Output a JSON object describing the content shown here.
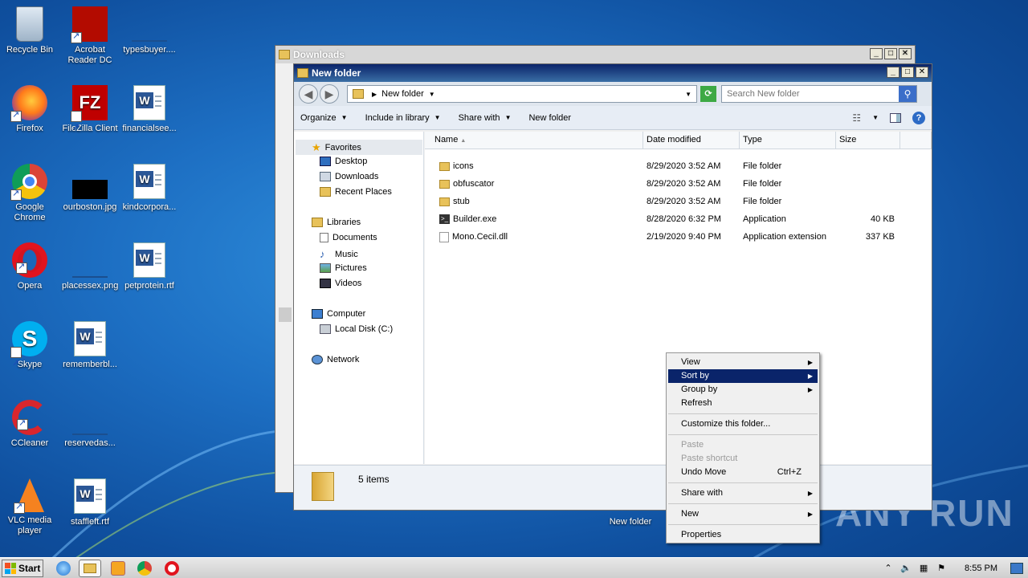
{
  "desktop": {
    "icons": [
      {
        "label": "Recycle Bin"
      },
      {
        "label": "Acrobat Reader DC"
      },
      {
        "label": "typesbuyer...."
      },
      {
        "label": "Firefox"
      },
      {
        "label": "FileZilla Client"
      },
      {
        "label": "financialsee..."
      },
      {
        "label": "Google Chrome"
      },
      {
        "label": "ourboston.jpg"
      },
      {
        "label": "kindcorpora..."
      },
      {
        "label": "Opera"
      },
      {
        "label": "placessex.png"
      },
      {
        "label": "petprotein.rtf"
      },
      {
        "label": "Skype"
      },
      {
        "label": "rememberbl..."
      },
      {
        "label": "CCleaner"
      },
      {
        "label": "reservedas..."
      },
      {
        "label": "VLC media player"
      },
      {
        "label": "staffleft.rtf"
      },
      {
        "label": "New folder"
      }
    ],
    "watermark": "ANY RUN"
  },
  "back_window": {
    "title": "Downloads"
  },
  "explorer": {
    "title": "New folder",
    "address": "New folder",
    "search_placeholder": "Search New folder",
    "commands": [
      "Organize",
      "Include in library",
      "Share with",
      "New folder"
    ],
    "nav": {
      "favorites": "Favorites",
      "fav_items": [
        "Desktop",
        "Downloads",
        "Recent Places"
      ],
      "libraries": "Libraries",
      "lib_items": [
        "Documents",
        "Music",
        "Pictures",
        "Videos"
      ],
      "computer": "Computer",
      "comp_items": [
        "Local Disk (C:)"
      ],
      "network": "Network"
    },
    "columns": [
      "Name",
      "Date modified",
      "Type",
      "Size"
    ],
    "files": [
      {
        "name": "icons",
        "date": "8/29/2020 3:52 AM",
        "type": "File folder",
        "size": "",
        "kind": "folder"
      },
      {
        "name": "obfuscator",
        "date": "8/29/2020 3:52 AM",
        "type": "File folder",
        "size": "",
        "kind": "folder"
      },
      {
        "name": "stub",
        "date": "8/29/2020 3:52 AM",
        "type": "File folder",
        "size": "",
        "kind": "folder"
      },
      {
        "name": "Builder.exe",
        "date": "8/28/2020 6:32 PM",
        "type": "Application",
        "size": "40 KB",
        "kind": "exe"
      },
      {
        "name": "Mono.Cecil.dll",
        "date": "2/19/2020 9:40 PM",
        "type": "Application extension",
        "size": "337 KB",
        "kind": "dll"
      }
    ],
    "status": "5 items"
  },
  "context_menu": {
    "items": [
      {
        "label": "View",
        "submenu": true
      },
      {
        "label": "Sort by",
        "submenu": true,
        "highlighted": true
      },
      {
        "label": "Group by",
        "submenu": true
      },
      {
        "label": "Refresh"
      },
      {
        "label": "Customize this folder..."
      },
      {
        "label": "Paste",
        "disabled": true
      },
      {
        "label": "Paste shortcut",
        "disabled": true
      },
      {
        "label": "Undo Move",
        "shortcut": "Ctrl+Z"
      },
      {
        "label": "Share with",
        "submenu": true
      },
      {
        "label": "New",
        "submenu": true
      },
      {
        "label": "Properties"
      }
    ]
  },
  "taskbar": {
    "start": "Start",
    "clock": "8:55 PM"
  },
  "colors": {
    "highlight": "#0a246a",
    "desktop": "#1d6fc3"
  }
}
